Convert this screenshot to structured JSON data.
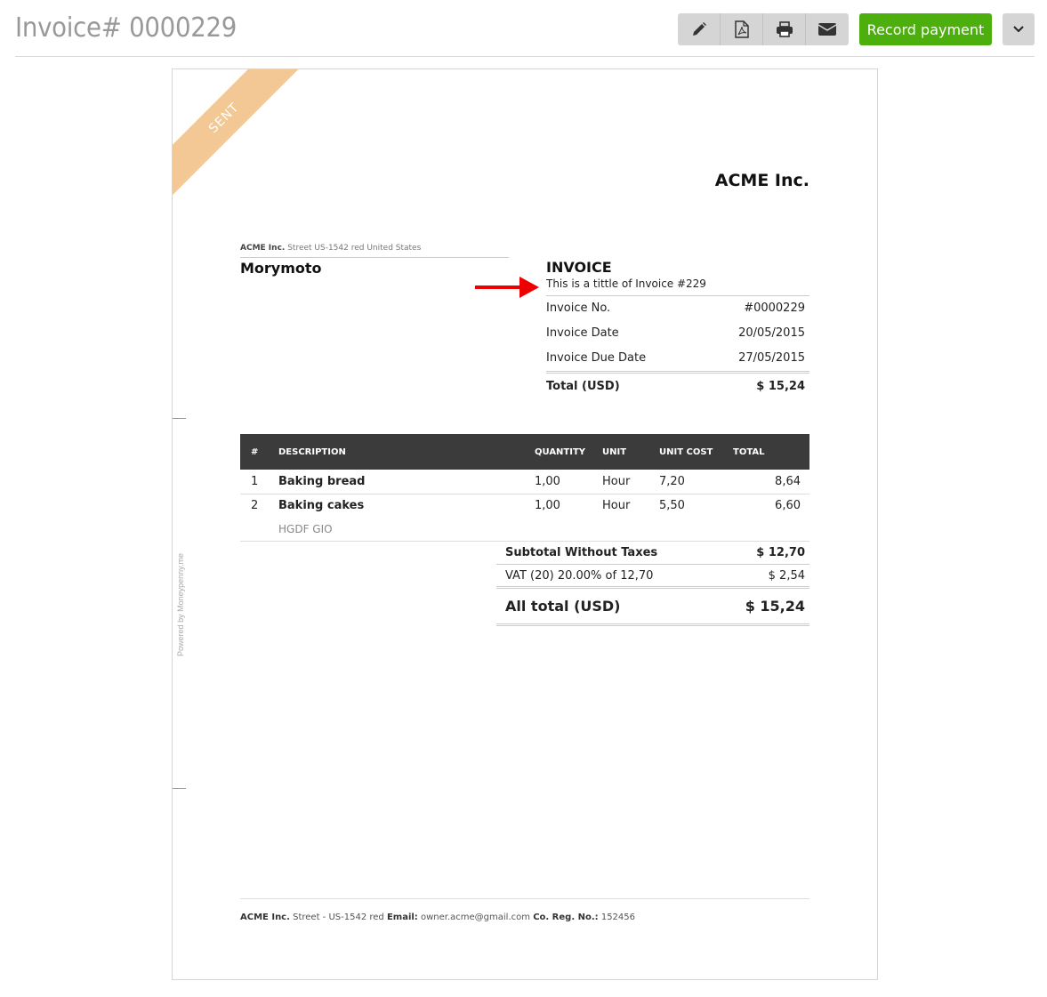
{
  "header": {
    "title": "Invoice# 0000229",
    "toolbar": [
      {
        "name": "edit-button",
        "icon": "pencil-icon"
      },
      {
        "name": "pdf-button",
        "icon": "pdf-icon"
      },
      {
        "name": "print-button",
        "icon": "printer-icon"
      },
      {
        "name": "email-button",
        "icon": "envelope-icon"
      }
    ],
    "record_payment_label": "Record payment",
    "more_icon": "chevron-down-icon",
    "accent_color": "#4daf0d"
  },
  "document": {
    "status_ribbon": "SENT",
    "status_color": "#f3c894",
    "powered_by": "Powered by Moneypenny.me",
    "company_name": "ACME Inc.",
    "sender": {
      "name": "ACME Inc.",
      "address": "Street US-1542 red United States"
    },
    "client_name": "Morymoto",
    "invoice": {
      "heading": "INVOICE",
      "subtitle": "This is a tittle of Invoice #229",
      "meta": [
        {
          "label": "Invoice No.",
          "value": "#0000229"
        },
        {
          "label": "Invoice Date",
          "value": "20/05/2015"
        },
        {
          "label": "Invoice Due Date",
          "value": "27/05/2015"
        }
      ],
      "total_label": "Total (USD)",
      "total_value": "$ 15,24"
    },
    "items_table": {
      "headers": [
        "#",
        "DESCRIPTION",
        "QUANTITY",
        "UNIT",
        "UNIT COST",
        "TOTAL"
      ],
      "rows": [
        {
          "num": "1",
          "description": "Baking bread",
          "note": "",
          "quantity": "1,00",
          "unit": "Hour",
          "unit_cost": "7,20",
          "total": "8,64"
        },
        {
          "num": "2",
          "description": "Baking cakes",
          "note": "HGDF GIO",
          "quantity": "1,00",
          "unit": "Hour",
          "unit_cost": "5,50",
          "total": "6,60"
        }
      ]
    },
    "totals": {
      "subtotal_label": "Subtotal Without Taxes",
      "subtotal_value": "$ 12,70",
      "vat_label": "VAT (20) 20.00% of 12,70",
      "vat_value": "$ 2,54",
      "all_total_label": "All total (USD)",
      "all_total_value": "$ 15,24"
    },
    "footer": {
      "company": "ACME Inc.",
      "street": "Street - US-1542 red",
      "email_label": "Email:",
      "email": "owner.acme@gmail.com",
      "reg_label": "Co. Reg. No.:",
      "reg_no": "152456"
    }
  }
}
